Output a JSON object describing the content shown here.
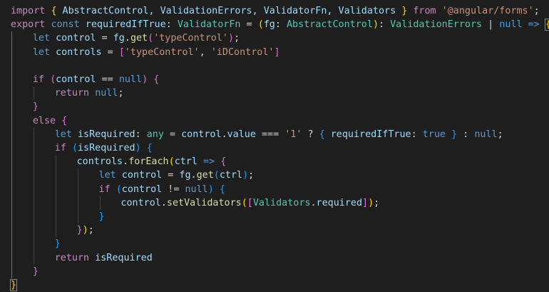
{
  "palette": {
    "background": "#1e1e1e",
    "keyword_control": "#c586c0",
    "keyword": "#569cd6",
    "variable": "#9cdcfe",
    "type": "#4ec9b0",
    "function": "#dcdcaa",
    "string": "#ce9178",
    "plain": "#d4d4d4",
    "bracket_gold": "#ffd700",
    "bracket_orchid": "#da70d6",
    "bracket_blue": "#179fff"
  },
  "code_lines": [
    {
      "indent": 0,
      "tokens": [
        {
          "t": "import",
          "c": "#c586c0"
        },
        {
          "t": " ",
          "c": "#d4d4d4"
        },
        {
          "t": "{",
          "c": "#ffd700"
        },
        {
          "t": " AbstractControl, ValidationErrors, ValidatorFn, Validators ",
          "c": "#9cdcfe"
        },
        {
          "t": "}",
          "c": "#ffd700"
        },
        {
          "t": " ",
          "c": "#d4d4d4"
        },
        {
          "t": "from",
          "c": "#c586c0"
        },
        {
          "t": " ",
          "c": "#d4d4d4"
        },
        {
          "t": "'@angular/forms'",
          "c": "#ce9178"
        },
        {
          "t": ";",
          "c": "#d4d4d4"
        }
      ]
    },
    {
      "indent": 0,
      "tokens": [
        {
          "t": "export",
          "c": "#c586c0"
        },
        {
          "t": " ",
          "c": "#d4d4d4"
        },
        {
          "t": "const",
          "c": "#569cd6"
        },
        {
          "t": " ",
          "c": "#d4d4d4"
        },
        {
          "t": "requiredIfTrue",
          "c": "#9cdcfe"
        },
        {
          "t": ": ",
          "c": "#d4d4d4"
        },
        {
          "t": "ValidatorFn",
          "c": "#4ec9b0"
        },
        {
          "t": " = ",
          "c": "#d4d4d4"
        },
        {
          "t": "(",
          "c": "#ffd700"
        },
        {
          "t": "fg",
          "c": "#9cdcfe"
        },
        {
          "t": ": ",
          "c": "#d4d4d4"
        },
        {
          "t": "AbstractControl",
          "c": "#4ec9b0"
        },
        {
          "t": ")",
          "c": "#ffd700"
        },
        {
          "t": ": ",
          "c": "#d4d4d4"
        },
        {
          "t": "ValidationErrors",
          "c": "#4ec9b0"
        },
        {
          "t": " | ",
          "c": "#d4d4d4"
        },
        {
          "t": "null",
          "c": "#569cd6"
        },
        {
          "t": " ",
          "c": "#d4d4d4"
        },
        {
          "t": "=>",
          "c": "#569cd6"
        },
        {
          "t": " ",
          "c": "#d4d4d4"
        },
        {
          "t": "{",
          "c": "#ffd700",
          "box": true
        }
      ]
    },
    {
      "indent": 1,
      "tokens": [
        {
          "t": "let",
          "c": "#569cd6"
        },
        {
          "t": " ",
          "c": "#d4d4d4"
        },
        {
          "t": "control",
          "c": "#9cdcfe"
        },
        {
          "t": " = ",
          "c": "#d4d4d4"
        },
        {
          "t": "fg",
          "c": "#9cdcfe"
        },
        {
          "t": ".",
          "c": "#d4d4d4"
        },
        {
          "t": "get",
          "c": "#dcdcaa"
        },
        {
          "t": "(",
          "c": "#da70d6"
        },
        {
          "t": "'typeControl'",
          "c": "#ce9178"
        },
        {
          "t": ")",
          "c": "#da70d6"
        },
        {
          "t": ";",
          "c": "#d4d4d4"
        }
      ]
    },
    {
      "indent": 1,
      "tokens": [
        {
          "t": "let",
          "c": "#569cd6"
        },
        {
          "t": " ",
          "c": "#d4d4d4"
        },
        {
          "t": "controls",
          "c": "#9cdcfe"
        },
        {
          "t": " = ",
          "c": "#d4d4d4"
        },
        {
          "t": "[",
          "c": "#da70d6"
        },
        {
          "t": "'typeControl'",
          "c": "#ce9178"
        },
        {
          "t": ", ",
          "c": "#d4d4d4"
        },
        {
          "t": "'iDControl'",
          "c": "#ce9178"
        },
        {
          "t": "]",
          "c": "#da70d6"
        }
      ]
    },
    {
      "indent": 0,
      "tokens": []
    },
    {
      "indent": 1,
      "tokens": [
        {
          "t": "if",
          "c": "#c586c0"
        },
        {
          "t": " ",
          "c": "#d4d4d4"
        },
        {
          "t": "(",
          "c": "#da70d6"
        },
        {
          "t": "control",
          "c": "#9cdcfe"
        },
        {
          "t": " == ",
          "c": "#d4d4d4"
        },
        {
          "t": "null",
          "c": "#569cd6"
        },
        {
          "t": ")",
          "c": "#da70d6"
        },
        {
          "t": " ",
          "c": "#d4d4d4"
        },
        {
          "t": "{",
          "c": "#da70d6"
        }
      ]
    },
    {
      "indent": 2,
      "tokens": [
        {
          "t": "return",
          "c": "#c586c0"
        },
        {
          "t": " ",
          "c": "#d4d4d4"
        },
        {
          "t": "null",
          "c": "#569cd6"
        },
        {
          "t": ";",
          "c": "#d4d4d4"
        }
      ]
    },
    {
      "indent": 1,
      "tokens": [
        {
          "t": "}",
          "c": "#da70d6"
        }
      ]
    },
    {
      "indent": 1,
      "tokens": [
        {
          "t": "else",
          "c": "#c586c0"
        },
        {
          "t": " ",
          "c": "#d4d4d4"
        },
        {
          "t": "{",
          "c": "#da70d6"
        }
      ]
    },
    {
      "indent": 2,
      "tokens": [
        {
          "t": "let",
          "c": "#569cd6"
        },
        {
          "t": " ",
          "c": "#d4d4d4"
        },
        {
          "t": "isRequired",
          "c": "#9cdcfe"
        },
        {
          "t": ": ",
          "c": "#d4d4d4"
        },
        {
          "t": "any",
          "c": "#4ec9b0"
        },
        {
          "t": " = ",
          "c": "#d4d4d4"
        },
        {
          "t": "control",
          "c": "#9cdcfe"
        },
        {
          "t": ".",
          "c": "#d4d4d4"
        },
        {
          "t": "value",
          "c": "#9cdcfe"
        },
        {
          "t": " === ",
          "c": "#d4d4d4"
        },
        {
          "t": "'1'",
          "c": "#ce9178"
        },
        {
          "t": " ? ",
          "c": "#d4d4d4"
        },
        {
          "t": "{",
          "c": "#179fff"
        },
        {
          "t": " ",
          "c": "#d4d4d4"
        },
        {
          "t": "requiredIfTrue",
          "c": "#9cdcfe"
        },
        {
          "t": ": ",
          "c": "#d4d4d4"
        },
        {
          "t": "true",
          "c": "#569cd6"
        },
        {
          "t": " ",
          "c": "#d4d4d4"
        },
        {
          "t": "}",
          "c": "#179fff"
        },
        {
          "t": " : ",
          "c": "#d4d4d4"
        },
        {
          "t": "null",
          "c": "#569cd6"
        },
        {
          "t": ";",
          "c": "#d4d4d4"
        }
      ]
    },
    {
      "indent": 2,
      "tokens": [
        {
          "t": "if",
          "c": "#c586c0"
        },
        {
          "t": " ",
          "c": "#d4d4d4"
        },
        {
          "t": "(",
          "c": "#179fff"
        },
        {
          "t": "isRequired",
          "c": "#9cdcfe"
        },
        {
          "t": ")",
          "c": "#179fff"
        },
        {
          "t": " ",
          "c": "#d4d4d4"
        },
        {
          "t": "{",
          "c": "#179fff"
        }
      ]
    },
    {
      "indent": 3,
      "tokens": [
        {
          "t": "controls",
          "c": "#9cdcfe"
        },
        {
          "t": ".",
          "c": "#d4d4d4"
        },
        {
          "t": "forEach",
          "c": "#dcdcaa"
        },
        {
          "t": "(",
          "c": "#ffd700"
        },
        {
          "t": "ctrl",
          "c": "#9cdcfe"
        },
        {
          "t": " ",
          "c": "#d4d4d4"
        },
        {
          "t": "=>",
          "c": "#569cd6"
        },
        {
          "t": " ",
          "c": "#d4d4d4"
        },
        {
          "t": "{",
          "c": "#da70d6"
        }
      ]
    },
    {
      "indent": 4,
      "tokens": [
        {
          "t": "let",
          "c": "#569cd6"
        },
        {
          "t": " ",
          "c": "#d4d4d4"
        },
        {
          "t": "control",
          "c": "#9cdcfe"
        },
        {
          "t": " = ",
          "c": "#d4d4d4"
        },
        {
          "t": "fg",
          "c": "#9cdcfe"
        },
        {
          "t": ".",
          "c": "#d4d4d4"
        },
        {
          "t": "get",
          "c": "#dcdcaa"
        },
        {
          "t": "(",
          "c": "#179fff"
        },
        {
          "t": "ctrl",
          "c": "#9cdcfe"
        },
        {
          "t": ")",
          "c": "#179fff"
        },
        {
          "t": ";",
          "c": "#d4d4d4"
        }
      ]
    },
    {
      "indent": 4,
      "tokens": [
        {
          "t": "if",
          "c": "#c586c0"
        },
        {
          "t": " ",
          "c": "#d4d4d4"
        },
        {
          "t": "(",
          "c": "#179fff"
        },
        {
          "t": "control",
          "c": "#9cdcfe"
        },
        {
          "t": " != ",
          "c": "#d4d4d4"
        },
        {
          "t": "null",
          "c": "#569cd6"
        },
        {
          "t": ")",
          "c": "#179fff"
        },
        {
          "t": " ",
          "c": "#d4d4d4"
        },
        {
          "t": "{",
          "c": "#179fff"
        }
      ]
    },
    {
      "indent": 5,
      "tokens": [
        {
          "t": "control",
          "c": "#9cdcfe"
        },
        {
          "t": ".",
          "c": "#d4d4d4"
        },
        {
          "t": "setValidators",
          "c": "#dcdcaa"
        },
        {
          "t": "(",
          "c": "#ffd700"
        },
        {
          "t": "[",
          "c": "#da70d6"
        },
        {
          "t": "Validators",
          "c": "#4ec9b0"
        },
        {
          "t": ".",
          "c": "#d4d4d4"
        },
        {
          "t": "required",
          "c": "#9cdcfe"
        },
        {
          "t": "]",
          "c": "#da70d6"
        },
        {
          "t": ")",
          "c": "#ffd700"
        },
        {
          "t": ";",
          "c": "#d4d4d4"
        }
      ]
    },
    {
      "indent": 4,
      "tokens": [
        {
          "t": "}",
          "c": "#179fff"
        }
      ]
    },
    {
      "indent": 3,
      "tokens": [
        {
          "t": "}",
          "c": "#da70d6"
        },
        {
          "t": ")",
          "c": "#ffd700"
        },
        {
          "t": ";",
          "c": "#d4d4d4"
        }
      ]
    },
    {
      "indent": 2,
      "tokens": [
        {
          "t": "}",
          "c": "#179fff"
        }
      ]
    },
    {
      "indent": 2,
      "tokens": [
        {
          "t": "return",
          "c": "#c586c0"
        },
        {
          "t": " ",
          "c": "#d4d4d4"
        },
        {
          "t": "isRequired",
          "c": "#9cdcfe"
        }
      ]
    },
    {
      "indent": 1,
      "tokens": [
        {
          "t": "}",
          "c": "#da70d6"
        }
      ]
    },
    {
      "indent": 0,
      "tokens": [
        {
          "t": "}",
          "c": "#ffd700",
          "box": true
        }
      ]
    }
  ]
}
